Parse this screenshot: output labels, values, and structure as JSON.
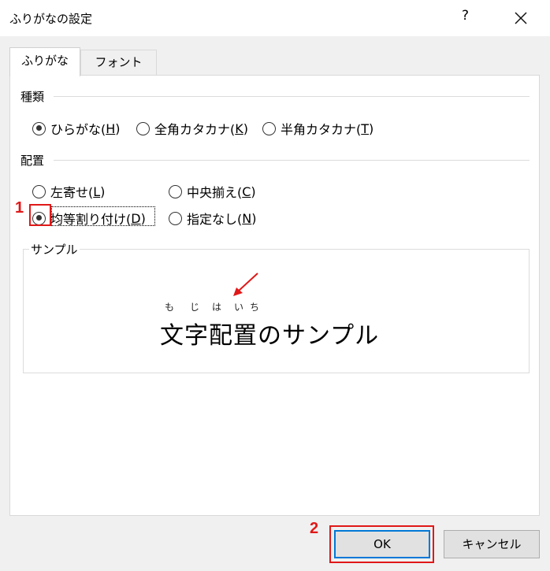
{
  "window": {
    "title": "ふりがなの設定",
    "help": "?",
    "close_icon": "close-icon"
  },
  "tabs": [
    {
      "label": "ふりがな",
      "active": true
    },
    {
      "label": "フォント",
      "active": false
    }
  ],
  "type_group": {
    "title": "種類",
    "options": [
      {
        "text": "ひらがな(",
        "key": "H",
        "tail": ")",
        "selected": true
      },
      {
        "text": "全角カタカナ(",
        "key": "K",
        "tail": ")",
        "selected": false
      },
      {
        "text": "半角カタカナ(",
        "key": "T",
        "tail": ")",
        "selected": false
      }
    ]
  },
  "align_group": {
    "title": "配置",
    "options": [
      {
        "text": "左寄せ(",
        "key": "L",
        "tail": ")",
        "selected": false
      },
      {
        "text": "中央揃え(",
        "key": "C",
        "tail": ")",
        "selected": false
      },
      {
        "text": "均等割り付け(",
        "key": "D",
        "tail": ")",
        "selected": true
      },
      {
        "text": "指定なし(",
        "key": "N",
        "tail": ")",
        "selected": false
      }
    ]
  },
  "sample": {
    "title": "サンプル",
    "furigana": [
      "も",
      "じ",
      "は",
      "い",
      "ち"
    ],
    "text": "文字配置のサンプル"
  },
  "buttons": {
    "ok": "OK",
    "cancel": "キャンセル"
  },
  "annotations": {
    "marker1": "1",
    "marker2": "2",
    "accent": "#e01818"
  }
}
